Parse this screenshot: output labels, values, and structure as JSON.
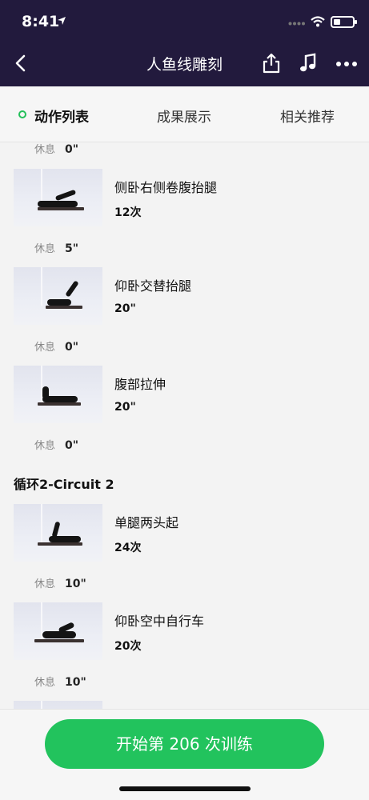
{
  "status_bar": {
    "time": "8:41"
  },
  "nav": {
    "title": "人鱼线雕刻"
  },
  "tabs": [
    {
      "label": "动作列表",
      "active": true
    },
    {
      "label": "成果展示",
      "active": false
    },
    {
      "label": "相关推荐",
      "active": false
    }
  ],
  "rest_label": "休息",
  "list": {
    "rests": [
      "0\"",
      "5\"",
      "0\"",
      "0\"",
      "10\"",
      "10\""
    ],
    "exercises": [
      {
        "name": "侧卧右侧卷腹抬腿",
        "count": "12次"
      },
      {
        "name": "仰卧交替抬腿",
        "count": "20\""
      },
      {
        "name": "腹部拉伸",
        "count": "20\""
      },
      {
        "name": "单腿两头起",
        "count": "24次"
      },
      {
        "name": "仰卧空中自行车",
        "count": "20次"
      }
    ],
    "circuit_title": "循环2-Circuit 2"
  },
  "bottom": {
    "start_button": "开始第 206 次训练"
  },
  "colors": {
    "header_bg": "#221a3d",
    "accent_green": "#22c35d"
  }
}
